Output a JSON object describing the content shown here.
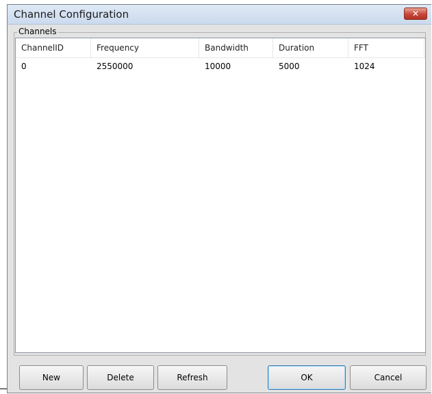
{
  "window": {
    "title": "Channel Configuration"
  },
  "group": {
    "label": "Channels"
  },
  "table": {
    "columns": [
      "ChannelID",
      "Frequency",
      "Bandwidth",
      "Duration",
      "FFT"
    ],
    "rows": [
      [
        "0",
        "2550000",
        "10000",
        "5000",
        "1024"
      ]
    ]
  },
  "buttons": {
    "new": "New",
    "delete": "Delete",
    "refresh": "Refresh",
    "ok": "OK",
    "cancel": "Cancel"
  },
  "colors": {
    "close_button": "#c7463a",
    "titlebar": "#cbdaee",
    "dialog_background": "#e3e3e3",
    "default_button_border": "#3c7fb1"
  },
  "icons": {
    "close": "close-icon"
  }
}
